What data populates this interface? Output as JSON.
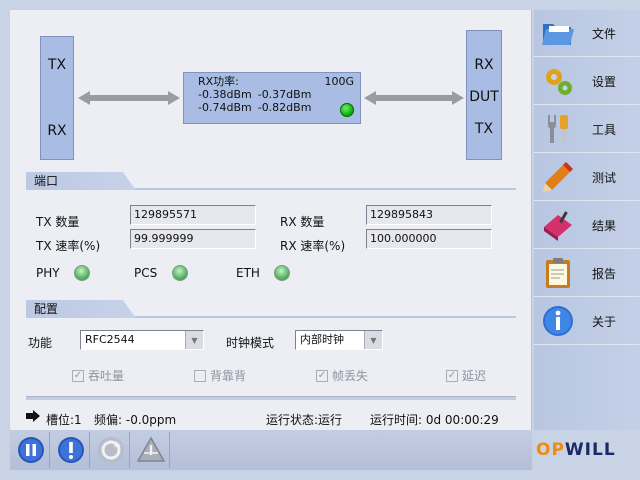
{
  "diagram": {
    "left_box": {
      "top": "TX",
      "bottom": "RX"
    },
    "right_box": {
      "top": "RX",
      "middle": "DUT",
      "bottom": "TX"
    },
    "rx_power_label": "RX功率:",
    "rate": "100G",
    "values_row1": [
      "-0.38dBm",
      "-0.37dBm"
    ],
    "values_row2": [
      "-0.74dBm",
      "-0.82dBm"
    ]
  },
  "port_section": {
    "title": "端口",
    "tx_count_label": "TX 数量",
    "tx_count_value": "129895571",
    "rx_count_label": "RX 数量",
    "rx_count_value": "129895843",
    "tx_rate_label": "TX 速率(%)",
    "tx_rate_value": "99.999999",
    "rx_rate_label": "RX 速率(%)",
    "rx_rate_value": "100.000000",
    "indicators": [
      "PHY",
      "PCS",
      "ETH"
    ]
  },
  "config_section": {
    "title": "配置",
    "function_label": "功能",
    "function_value": "RFC2544",
    "clock_label": "时钟模式",
    "clock_value": "内部时钟",
    "checkboxes": [
      "吞吐量",
      "背靠背",
      "帧丢失",
      "延迟"
    ],
    "checked": [
      true,
      false,
      true,
      true
    ]
  },
  "status": {
    "slot": "槽位:1",
    "freq": "频偏: -0.0ppm",
    "run_state": "运行状态:运行",
    "run_time": "运行时间: 0d  00:00:29"
  },
  "sidebar": {
    "items": [
      {
        "label": "文件",
        "icon": "folder-icon"
      },
      {
        "label": "设置",
        "icon": "gears-icon"
      },
      {
        "label": "工具",
        "icon": "tools-icon"
      },
      {
        "label": "测试",
        "icon": "pencil-icon"
      },
      {
        "label": "结果",
        "icon": "eraser-icon"
      },
      {
        "label": "报告",
        "icon": "clipboard-icon"
      },
      {
        "label": "关于",
        "icon": "info-icon"
      }
    ]
  },
  "logo": {
    "op": "OP",
    "will": "WILL"
  }
}
